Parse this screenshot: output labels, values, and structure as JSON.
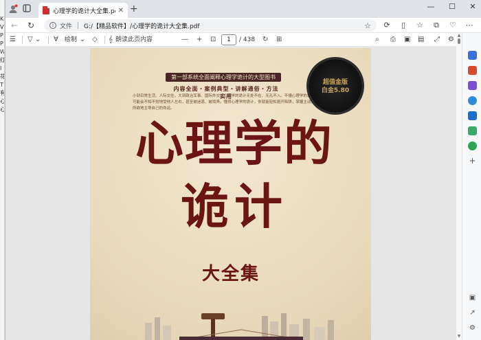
{
  "background_window": {
    "left_strip_chars": [
      "K",
      "V",
      "P",
      "P",
      "W",
      "红",
      "I",
      "花",
      "T",
      "有",
      "心",
      "心"
    ]
  },
  "browser": {
    "tab": {
      "title": "心理学的诡计大全集.pdf",
      "close_icon": "close-icon"
    },
    "address": {
      "file_label": "文件",
      "url": "G:/【精品软件】/心理学的诡计大全集.pdf"
    },
    "window_controls": [
      "minimize-icon",
      "maximize-icon",
      "close-icon"
    ]
  },
  "pdf_toolbar": {
    "draw_label": "绘制",
    "read_aloud_label": "朗读此页内容",
    "current_page": "1",
    "total_pages": "/ 438"
  },
  "document": {
    "banner": "第一部系统全面阐释心理学诡计的大型图书",
    "subtitle": "内容全面・案例典型・讲解通俗・方法实用",
    "paragraph": "小到日常生活、人际交往，大到政治军事、国际外交，心理学的诡计无处不在、无孔不入。不懂心理学的诡计，你可能会不知不觉地受他人左右，甚至被迷惑、被戏弄。懂得心理学的诡计，你就能轻松避开陷阱，掌握主动，随心所欲地主导自己的命运。",
    "seal_text": "超值金版\n白金5.80",
    "title_line1": "心理学的",
    "title_line2": "诡计",
    "title_line3": "大全集"
  },
  "colors": {
    "title": "#6b1614",
    "banner_bg": "#4a2525",
    "page_bg": "#e9dcc1",
    "tab_strip": "#dfe3e8"
  }
}
